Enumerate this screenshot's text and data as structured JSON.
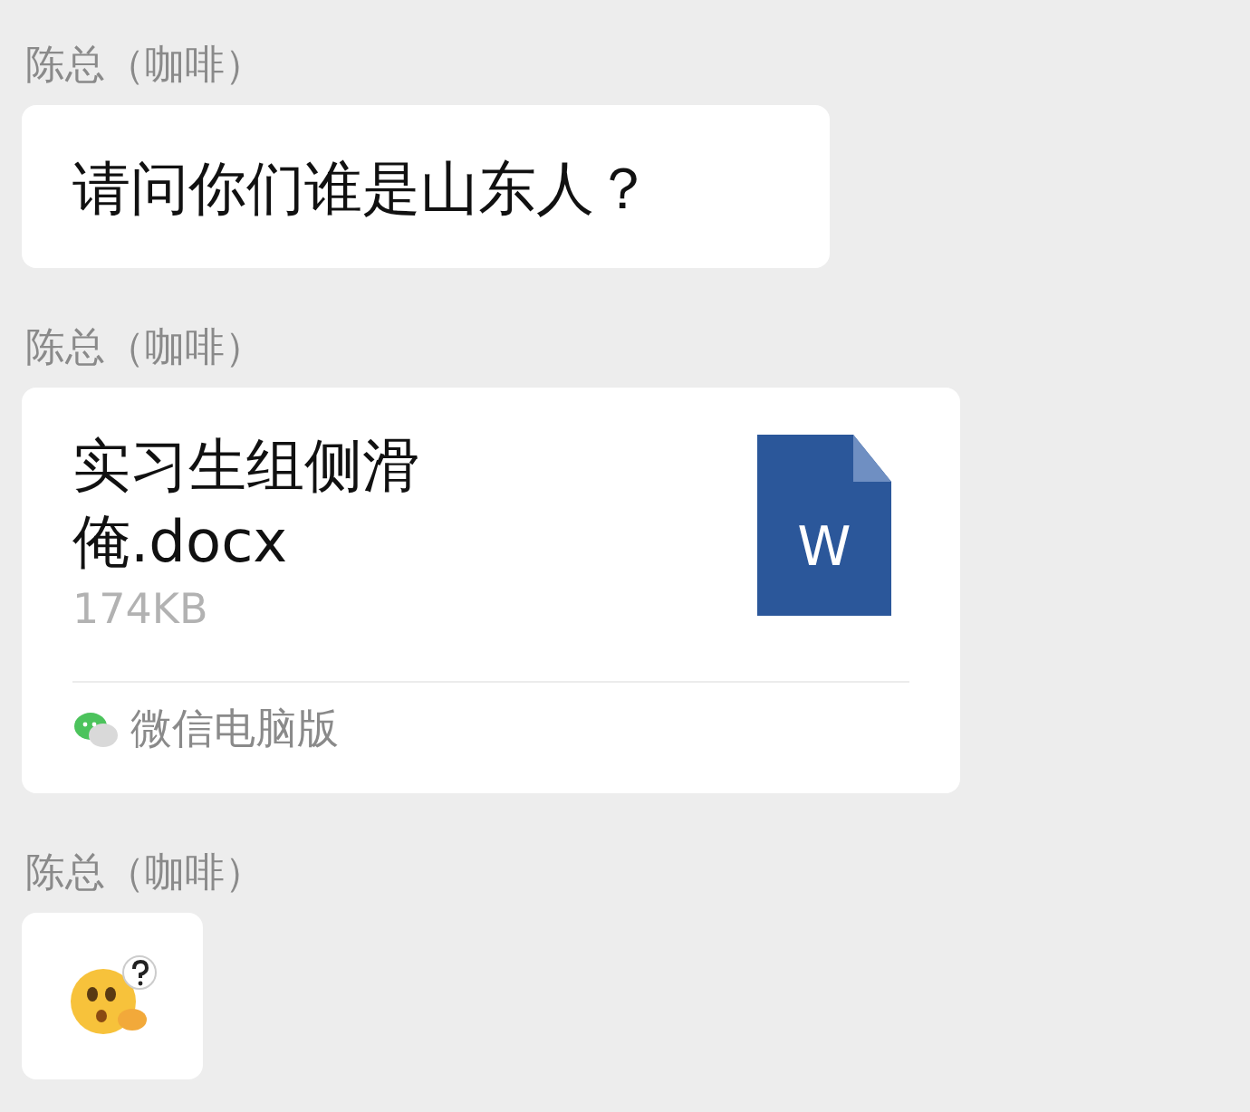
{
  "messages": [
    {
      "kind": "text",
      "sender": "陈总（咖啡）",
      "text": "请问你们谁是山东人？"
    },
    {
      "kind": "file",
      "sender": "陈总（咖啡）",
      "file_name": "实习生组侧滑俺.docx",
      "size": "174KB",
      "type_letter": "W",
      "source": "微信电脑版"
    },
    {
      "kind": "sticker",
      "sender": "陈总（咖啡）"
    }
  ]
}
